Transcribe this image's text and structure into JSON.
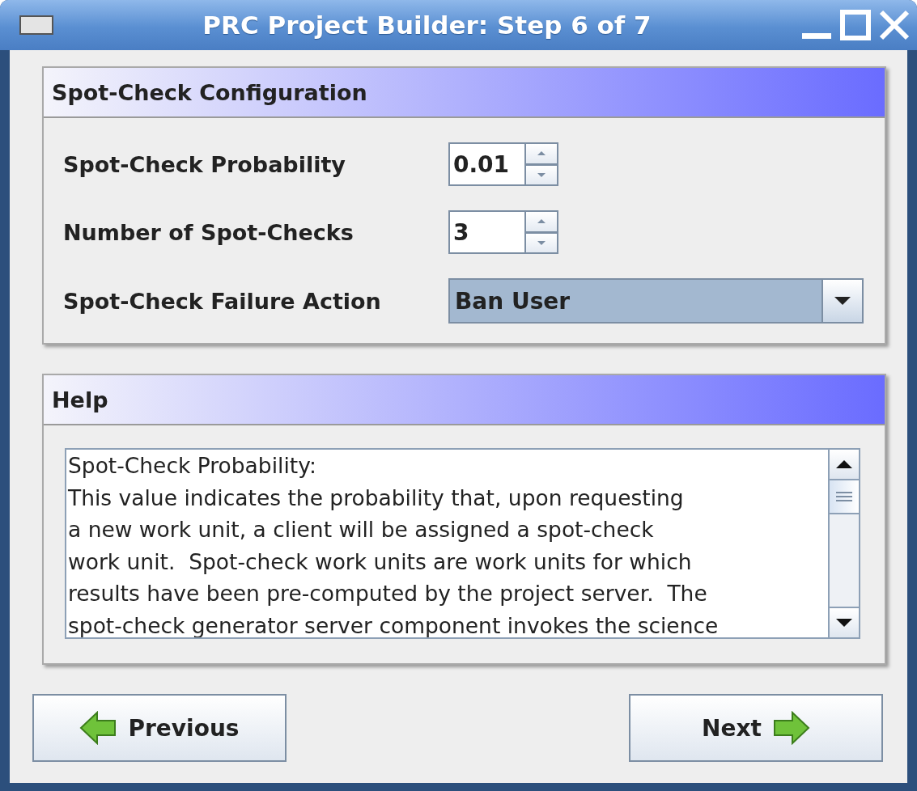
{
  "window": {
    "title": "PRC Project Builder: Step 6 of 7"
  },
  "config_panel": {
    "title": "Spot-Check Configuration",
    "fields": [
      {
        "kind": "spinner",
        "label": "Spot-Check Probability",
        "value": "0.01"
      },
      {
        "kind": "spinner",
        "label": "Number of Spot-Checks",
        "value": "3"
      },
      {
        "kind": "dropdown",
        "label": "Spot-Check Failure Action",
        "value": "Ban User"
      }
    ]
  },
  "help_panel": {
    "title": "Help",
    "lines": [
      "Spot-Check Probability:",
      "This value indicates the probability that, upon requesting",
      "a new work unit, a client will be assigned a spot-check",
      "work unit.  Spot-check work units are work units for which",
      "results have been pre-computed by the project server.  The",
      "spot-check generator server component invokes the science"
    ]
  },
  "buttons": [
    {
      "kind": "previous",
      "label": "Previous"
    },
    {
      "kind": "next",
      "label": "Next"
    }
  ]
}
